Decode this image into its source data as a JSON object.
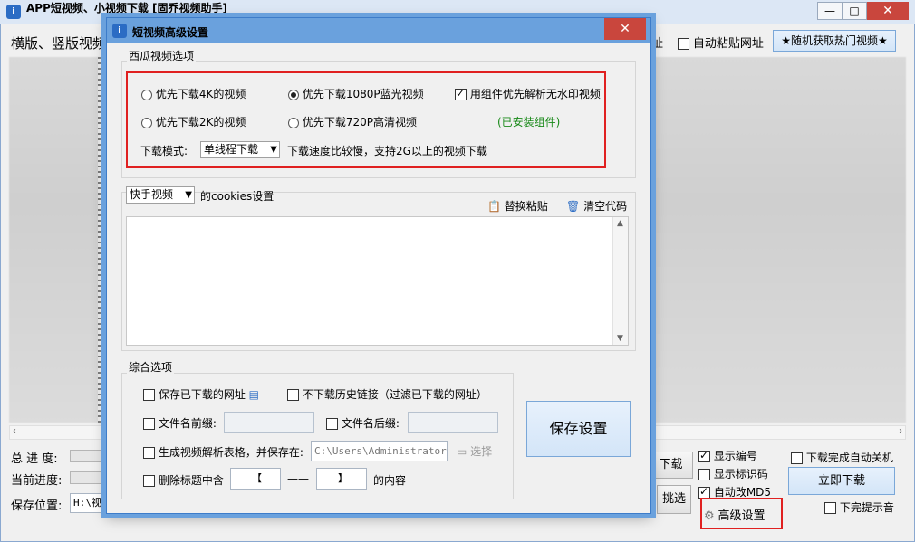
{
  "main_window": {
    "title": "APP短视频、小视频下载 [固乔视频助手]",
    "toolbar_left_text": "横版、竖版视频",
    "toolbar_partial_text": "址",
    "auto_paste_label": "自动粘贴网址",
    "random_hot_button": "★随机获取热门视频★",
    "total_progress_label": "总 进 度:",
    "current_progress_label": "当前进度:",
    "save_location_label": "保存位置:",
    "save_location_value": "H:\\视频",
    "download_button_partial": "下载",
    "pick_button": "挑选",
    "show_number_label": "显示编号",
    "show_mark_label": "显示标识码",
    "auto_md5_label": "自动改MD5",
    "advanced_settings_button": "高级设置",
    "shutdown_label": "下载完成自动关机",
    "download_now_button": "立即下载",
    "sound_label": "下完提示音"
  },
  "dialog": {
    "title": "短视频高级设置",
    "xigua_group_title": "西瓜视频选项",
    "opt_4k": "优先下载4K的视频",
    "opt_1080p": "优先下载1080P蓝光视频",
    "opt_component": "用组件优先解析无水印视频",
    "opt_2k": "优先下载2K的视频",
    "opt_720p": "优先下载720P高清视频",
    "component_installed": "(已安装组件)",
    "download_mode_label": "下载模式:",
    "download_mode_value": "单线程下载",
    "download_mode_note": "下载速度比较慢，支持2G以上的视频下载",
    "cookies_select": "快手视频",
    "cookies_label": "的cookies设置",
    "replace_paste": "替换粘贴",
    "clear_code": "清空代码",
    "general_group_title": "综合选项",
    "save_downloaded_urls": "保存已下载的网址",
    "no_history_links": "不下载历史链接（过滤已下载的网址）",
    "filename_prefix_label": "文件名前缀:",
    "filename_suffix_label": "文件名后缀:",
    "gen_table_label": "生成视频解析表格，并保存在:",
    "table_path": "C:\\Users\\Administrator\\De",
    "choose_button": "选择",
    "delete_title_label": "删除标题中含",
    "bracket_left": "【",
    "dash": "——",
    "bracket_right": "】",
    "content_label": "的内容",
    "save_button": "保存设置"
  },
  "state": {
    "auto_paste": false,
    "radio_selected": "1080p",
    "use_component": true,
    "save_downloaded_urls": false,
    "no_history_links": false,
    "filename_prefix": false,
    "filename_suffix": false,
    "gen_table": false,
    "delete_title": false,
    "show_number": true,
    "show_mark": false,
    "auto_md5": true,
    "shutdown": false,
    "sound": false
  },
  "colors": {
    "highlight_border": "#e02020",
    "dialog_accent": "#6aa1dd",
    "installed_text": "#1a8a1a",
    "close_button": "#c9463d"
  }
}
